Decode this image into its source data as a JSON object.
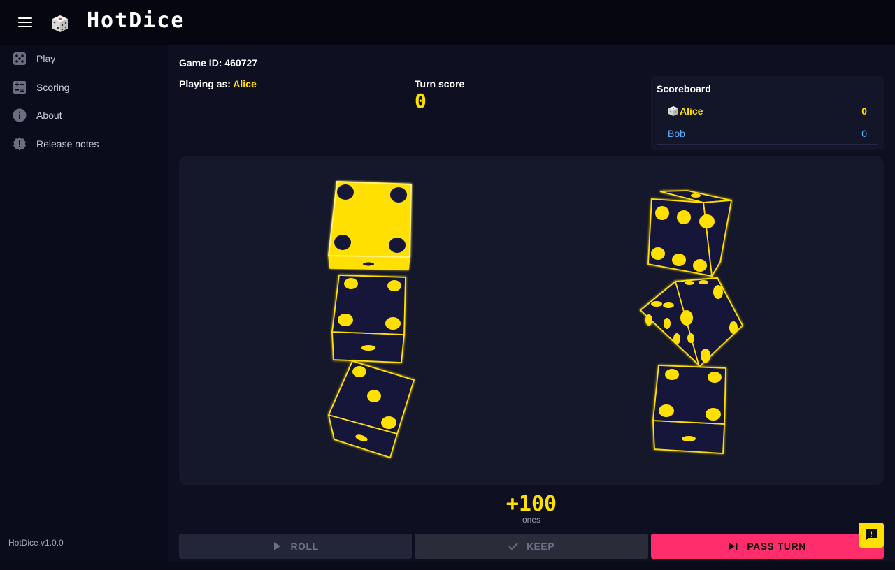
{
  "header": {
    "title": "HotDice"
  },
  "sidebar": {
    "items": [
      {
        "label": "Play",
        "icon": "dice-icon"
      },
      {
        "label": "Scoring",
        "icon": "calculator-icon"
      },
      {
        "label": "About",
        "icon": "info-icon"
      },
      {
        "label": "Release notes",
        "icon": "badge-alert-icon"
      }
    ],
    "version": "HotDice v1.0.0"
  },
  "game": {
    "game_id_label": "Game ID: 460727",
    "playing_as_label": "Playing as: ",
    "player_name": "Alice",
    "turn_score_label": "Turn score",
    "turn_score": "0"
  },
  "scoreboard": {
    "title": "Scoreboard",
    "players": [
      {
        "name": "Alice",
        "score": "0",
        "current": true
      },
      {
        "name": "Bob",
        "score": "0",
        "current": false
      }
    ]
  },
  "dice": {
    "face_values": [
      4,
      4,
      3,
      6,
      5,
      4
    ],
    "held": [
      true,
      false,
      false,
      false,
      false,
      false
    ],
    "accent_color": "#ffe000",
    "die_body_color": "#14163a"
  },
  "selection": {
    "points": "+100",
    "description": "ones"
  },
  "actions": {
    "roll_label": "ROLL",
    "keep_label": "KEEP",
    "pass_label": "PASS TURN"
  },
  "colors": {
    "accent": "#ffe000",
    "pass_button": "#ff2d6b",
    "secondary_player": "#5ab4ff"
  }
}
